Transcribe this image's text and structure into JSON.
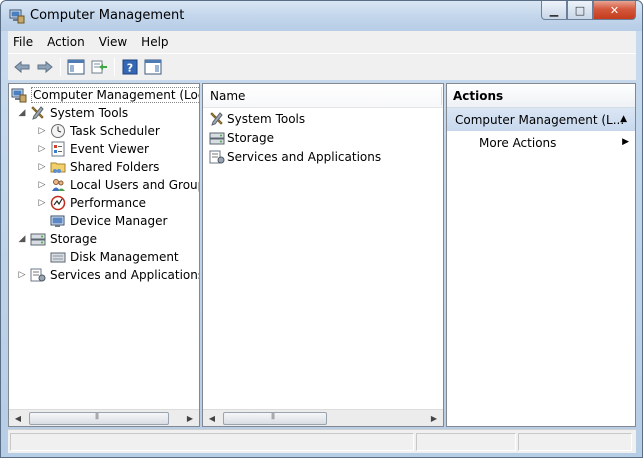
{
  "window": {
    "title": "Computer Management",
    "controls": {
      "minimize": "▁",
      "maximize": "□",
      "close": "✕"
    }
  },
  "menu": [
    "File",
    "Action",
    "View",
    "Help"
  ],
  "toolbar": {
    "icons": [
      "back-arrow-icon",
      "forward-arrow-icon",
      "show-hide-console-tree-icon",
      "export-list-icon",
      "help-icon",
      "show-hide-action-pane-icon"
    ]
  },
  "tree": {
    "root": "Computer Management (Local",
    "system_tools": "System Tools",
    "task_scheduler": "Task Scheduler",
    "event_viewer": "Event Viewer",
    "shared_folders": "Shared Folders",
    "local_users": "Local Users and Groups",
    "performance": "Performance",
    "device_manager": "Device Manager",
    "storage": "Storage",
    "disk_management": "Disk Management",
    "services": "Services and Applications"
  },
  "list": {
    "column_name": "Name",
    "items": [
      "System Tools",
      "Storage",
      "Services and Applications"
    ]
  },
  "actions": {
    "header": "Actions",
    "group": "Computer Management (L...",
    "more": "More Actions"
  },
  "colors": {
    "accent": "#c7d8ee",
    "title_bar": "#c3d6ec",
    "close_button": "#c43c1c"
  }
}
